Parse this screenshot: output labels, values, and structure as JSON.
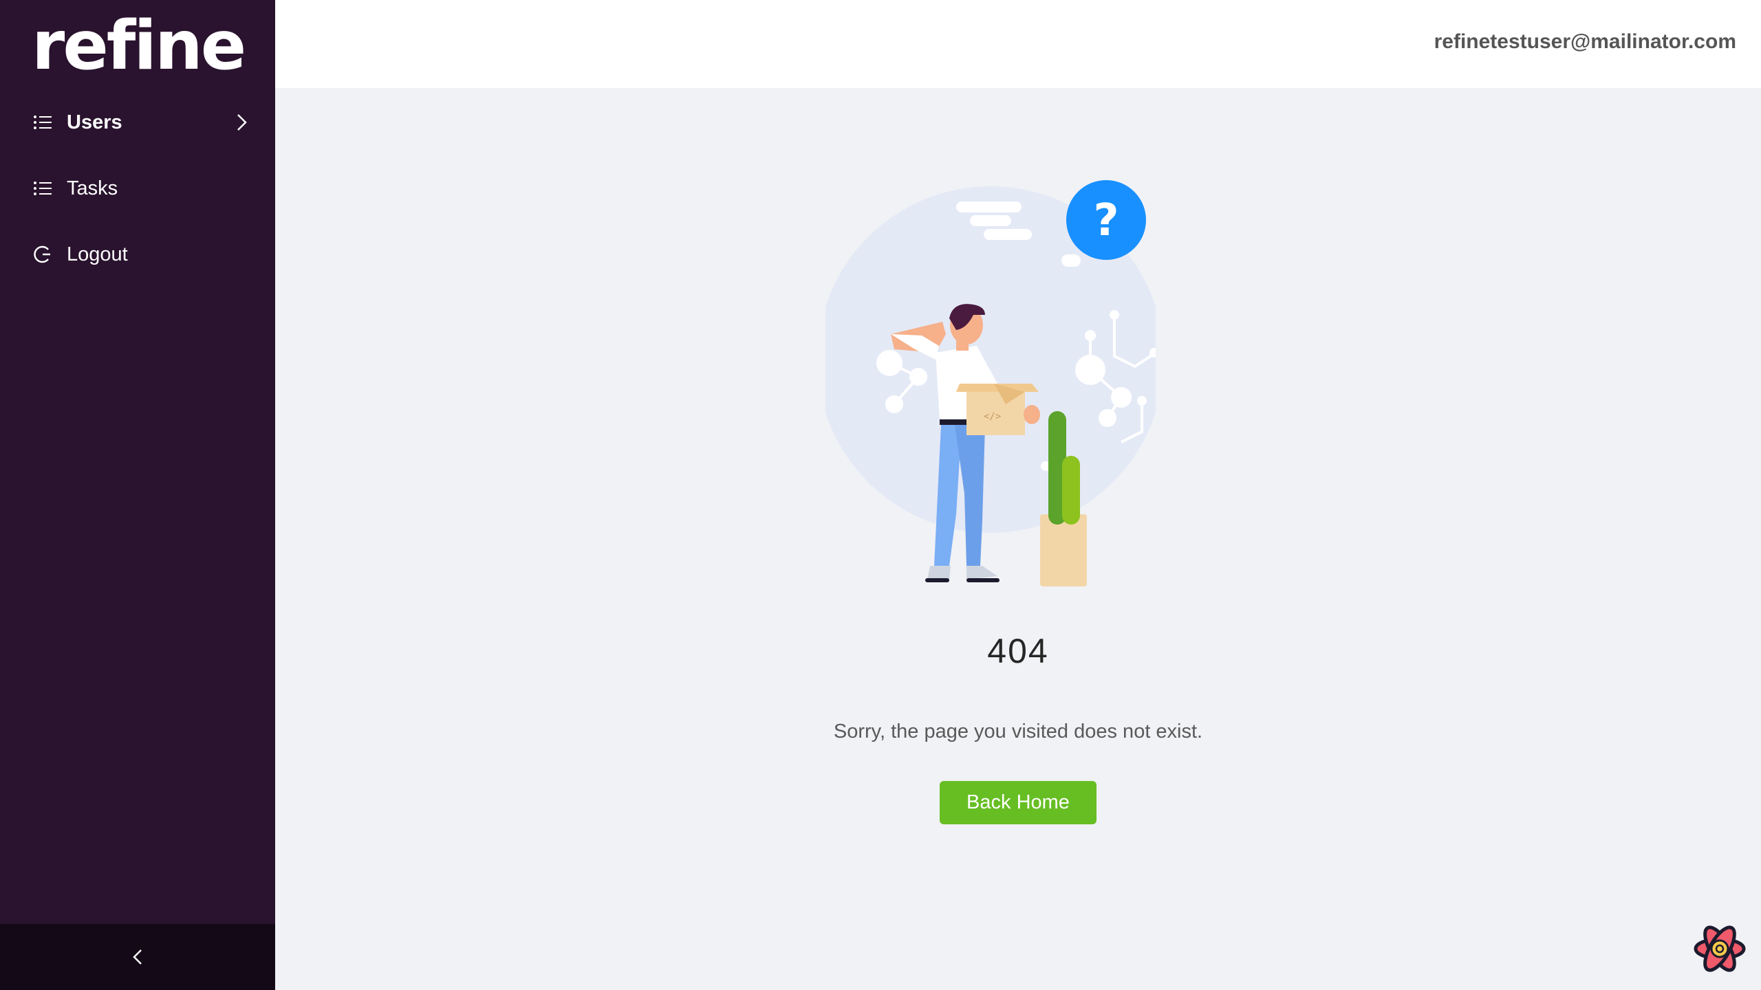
{
  "brand": {
    "logo_text": "refine"
  },
  "sidebar": {
    "items": [
      {
        "label": "Users",
        "icon": "list-icon",
        "active": true
      },
      {
        "label": "Tasks",
        "icon": "list-icon",
        "active": false
      },
      {
        "label": "Logout",
        "icon": "logout-icon",
        "active": false
      }
    ]
  },
  "header": {
    "user_email": "refinetestuser@mailinator.com"
  },
  "error_page": {
    "status_code": "404",
    "message": "Sorry, the page you visited does not exist.",
    "button_label": "Back Home",
    "illustration_glyph": "?"
  },
  "colors": {
    "sidebar_bg": "#2a132e",
    "accent_green": "#67be23",
    "question_blue": "#1890ff"
  }
}
